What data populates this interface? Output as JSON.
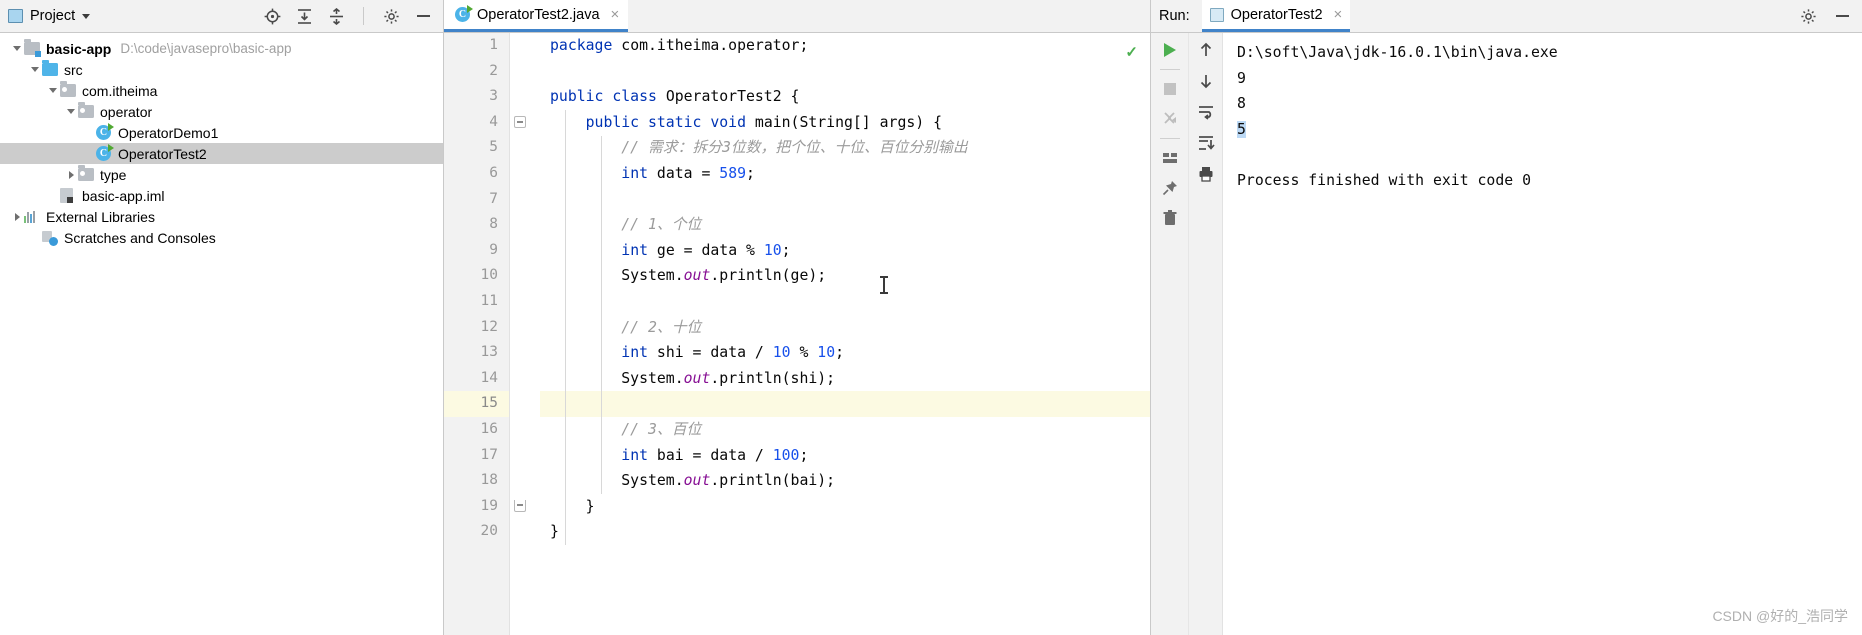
{
  "project_panel": {
    "title": "Project",
    "icons": [
      "project-view-icon",
      "locate-icon",
      "expand-all-icon",
      "collapse-all-icon",
      "settings-gear-icon",
      "minimize-icon"
    ],
    "tree": [
      {
        "label": "basic-app",
        "path": "D:\\code\\javasepro\\basic-app",
        "icon": "module-folder-icon",
        "depth": 0,
        "arrow": "down",
        "bold": true,
        "selected": false
      },
      {
        "label": "src",
        "path": "",
        "icon": "source-folder-icon",
        "depth": 1,
        "arrow": "down",
        "bold": false,
        "selected": false
      },
      {
        "label": "com.itheima",
        "path": "",
        "icon": "package-folder-icon",
        "depth": 2,
        "arrow": "down",
        "bold": false,
        "selected": false
      },
      {
        "label": "operator",
        "path": "",
        "icon": "package-folder-icon",
        "depth": 3,
        "arrow": "down",
        "bold": false,
        "selected": false
      },
      {
        "label": "OperatorDemo1",
        "path": "",
        "icon": "java-class-icon",
        "depth": 4,
        "arrow": "none",
        "bold": false,
        "selected": false
      },
      {
        "label": "OperatorTest2",
        "path": "",
        "icon": "java-class-icon",
        "depth": 4,
        "arrow": "none",
        "bold": false,
        "selected": true
      },
      {
        "label": "type",
        "path": "",
        "icon": "package-folder-icon",
        "depth": 3,
        "arrow": "right",
        "bold": false,
        "selected": false
      },
      {
        "label": "basic-app.iml",
        "path": "",
        "icon": "iml-file-icon",
        "depth": 2,
        "arrow": "none",
        "bold": false,
        "selected": false
      },
      {
        "label": "External Libraries",
        "path": "",
        "icon": "libraries-icon",
        "depth": 0,
        "arrow": "right",
        "bold": false,
        "selected": false
      },
      {
        "label": "Scratches and Consoles",
        "path": "",
        "icon": "scratches-icon",
        "depth": 1,
        "arrow": "none",
        "bold": false,
        "selected": false
      }
    ]
  },
  "editor": {
    "tab_label": "OperatorTest2.java",
    "tab_icon": "java-class-icon",
    "close_label": "×",
    "inspection_ok": "✓",
    "caret_line": 15,
    "lines": [
      {
        "n": 1,
        "run": false,
        "fold": "none",
        "tokens": [
          {
            "t": "package ",
            "c": "kw"
          },
          {
            "t": "com.itheima.operator;",
            "c": "ident"
          }
        ],
        "indent": 0
      },
      {
        "n": 2,
        "run": false,
        "fold": "none",
        "tokens": [],
        "indent": 0
      },
      {
        "n": 3,
        "run": true,
        "fold": "none",
        "tokens": [
          {
            "t": "public class ",
            "c": "kw"
          },
          {
            "t": "OperatorTest2 {",
            "c": "ident"
          }
        ],
        "indent": 0
      },
      {
        "n": 4,
        "run": true,
        "fold": "start",
        "tokens": [
          {
            "t": "    public static void ",
            "c": "kw"
          },
          {
            "t": "main(String[] args) {",
            "c": "ident"
          }
        ],
        "indent": 1
      },
      {
        "n": 5,
        "run": false,
        "fold": "none",
        "tokens": [
          {
            "t": "        // 需求：拆分3位数，把个位、十位、百位分别输出",
            "c": "cmt"
          }
        ],
        "indent": 2
      },
      {
        "n": 6,
        "run": false,
        "fold": "none",
        "tokens": [
          {
            "t": "        ",
            "c": "ident"
          },
          {
            "t": "int",
            "c": "kw"
          },
          {
            "t": " data = ",
            "c": "ident"
          },
          {
            "t": "589",
            "c": "num"
          },
          {
            "t": ";",
            "c": "ident"
          }
        ],
        "indent": 2
      },
      {
        "n": 7,
        "run": false,
        "fold": "none",
        "tokens": [],
        "indent": 2
      },
      {
        "n": 8,
        "run": false,
        "fold": "none",
        "tokens": [
          {
            "t": "        // 1、个位",
            "c": "cmt"
          }
        ],
        "indent": 2
      },
      {
        "n": 9,
        "run": false,
        "fold": "none",
        "tokens": [
          {
            "t": "        ",
            "c": "ident"
          },
          {
            "t": "int",
            "c": "kw"
          },
          {
            "t": " ge = data % ",
            "c": "ident"
          },
          {
            "t": "10",
            "c": "num"
          },
          {
            "t": ";",
            "c": "ident"
          }
        ],
        "indent": 2
      },
      {
        "n": 10,
        "run": false,
        "fold": "none",
        "tokens": [
          {
            "t": "        System.",
            "c": "ident"
          },
          {
            "t": "out",
            "c": "fld"
          },
          {
            "t": ".println(ge);",
            "c": "ident"
          }
        ],
        "indent": 2
      },
      {
        "n": 11,
        "run": false,
        "fold": "none",
        "tokens": [],
        "indent": 2
      },
      {
        "n": 12,
        "run": false,
        "fold": "none",
        "tokens": [
          {
            "t": "        // 2、十位",
            "c": "cmt"
          }
        ],
        "indent": 2
      },
      {
        "n": 13,
        "run": false,
        "fold": "none",
        "tokens": [
          {
            "t": "        ",
            "c": "ident"
          },
          {
            "t": "int",
            "c": "kw"
          },
          {
            "t": " shi = data / ",
            "c": "ident"
          },
          {
            "t": "10",
            "c": "num"
          },
          {
            "t": " % ",
            "c": "ident"
          },
          {
            "t": "10",
            "c": "num"
          },
          {
            "t": ";",
            "c": "ident"
          }
        ],
        "indent": 2
      },
      {
        "n": 14,
        "run": false,
        "fold": "none",
        "tokens": [
          {
            "t": "        System.",
            "c": "ident"
          },
          {
            "t": "out",
            "c": "fld"
          },
          {
            "t": ".println(shi);",
            "c": "ident"
          }
        ],
        "indent": 2
      },
      {
        "n": 15,
        "run": false,
        "fold": "none",
        "tokens": [],
        "indent": 2
      },
      {
        "n": 16,
        "run": false,
        "fold": "none",
        "tokens": [
          {
            "t": "        // 3、百位",
            "c": "cmt"
          }
        ],
        "indent": 2
      },
      {
        "n": 17,
        "run": false,
        "fold": "none",
        "tokens": [
          {
            "t": "        ",
            "c": "ident"
          },
          {
            "t": "int",
            "c": "kw"
          },
          {
            "t": " bai = data / ",
            "c": "ident"
          },
          {
            "t": "100",
            "c": "num"
          },
          {
            "t": ";",
            "c": "ident"
          }
        ],
        "indent": 2
      },
      {
        "n": 18,
        "run": false,
        "fold": "none",
        "tokens": [
          {
            "t": "        System.",
            "c": "ident"
          },
          {
            "t": "out",
            "c": "fld"
          },
          {
            "t": ".println(bai);",
            "c": "ident"
          }
        ],
        "indent": 2
      },
      {
        "n": 19,
        "run": false,
        "fold": "end",
        "tokens": [
          {
            "t": "    }",
            "c": "ident"
          }
        ],
        "indent": 1
      },
      {
        "n": 20,
        "run": false,
        "fold": "none",
        "tokens": [
          {
            "t": "}",
            "c": "ident"
          }
        ],
        "indent": 0
      }
    ]
  },
  "run_panel": {
    "label": "Run:",
    "tab_label": "OperatorTest2",
    "close_label": "×",
    "header_icons": [
      "settings-gear-icon",
      "minimize-icon"
    ],
    "toolbar_icons": [
      "run-icon",
      "stop-icon",
      "rerun-failed-icon",
      "layout-icon",
      "pin-icon",
      "trash-icon"
    ],
    "toolbar2_icons": [
      "scroll-up-icon",
      "scroll-down-icon",
      "soft-wrap-icon",
      "scroll-to-end-icon",
      "print-icon"
    ],
    "console": [
      {
        "text": "D:\\soft\\Java\\jdk-16.0.1\\bin\\java.exe",
        "highlight": false
      },
      {
        "text": "9",
        "highlight": false
      },
      {
        "text": "8",
        "highlight": false
      },
      {
        "text": "5",
        "highlight": true
      },
      {
        "text": "",
        "highlight": false
      },
      {
        "text": "Process finished with exit code 0",
        "highlight": false
      }
    ]
  },
  "watermark": {
    "text": "CSDN @好的_浩同学"
  },
  "colors": {
    "accent": "#4083c9",
    "keyword": "#0033b3",
    "number": "#1750eb",
    "comment": "#9b9b9b",
    "field": "#871094",
    "caret_line_bg": "#fcfae2",
    "selection_bg": "#bcd9f5",
    "tree_selected_bg": "#cccccc",
    "run_green": "#4caf50"
  }
}
